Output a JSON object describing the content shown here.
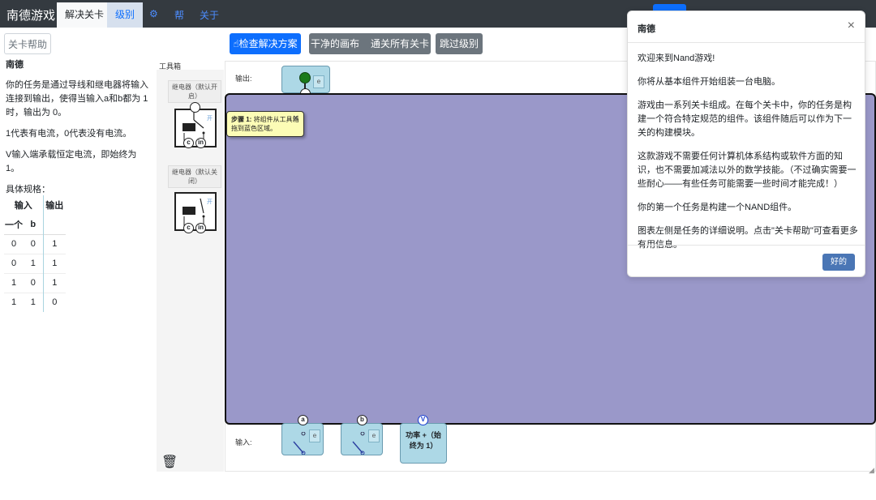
{
  "navbar": {
    "brand": "南德游戏",
    "tabs": [
      {
        "label": "解决关卡"
      },
      {
        "label": "级别"
      }
    ],
    "links": [
      {
        "label": "⚙"
      },
      {
        "label": "帮"
      },
      {
        "label": "关于"
      }
    ]
  },
  "toolbar": {
    "help_label": "关卡帮助",
    "check_label": "检查解决方案",
    "clear_label": "干净的画布",
    "pass_all_label": "通关所有关卡",
    "skip_label": "跳过级别"
  },
  "spec": {
    "title": "南德",
    "p1": "你的任务是通过导线和继电器将输入连接到输出，使得当输入a和b都为 1 时，输出为 0。",
    "p2": "1代表有电流，0代表没有电流。",
    "p3": "V输入端承载恒定电流，即始终为 1。",
    "p4": "具体规格：",
    "table": {
      "header_in": "输入",
      "header_out": "输出",
      "sub_a": "一个",
      "sub_b": "b",
      "rows": [
        [
          "0",
          "0",
          "1"
        ],
        [
          "0",
          "1",
          "1"
        ],
        [
          "1",
          "0",
          "1"
        ],
        [
          "1",
          "1",
          "0"
        ]
      ]
    }
  },
  "toolbox": {
    "label": "工具箱",
    "relay_on": "继电器（默认开启）",
    "relay_off": "继电器（默认关闭）",
    "port_c": "c",
    "port_in": "in"
  },
  "canvas": {
    "output_label": "输出:",
    "input_label": "输入:",
    "input_a": "a",
    "input_b": "b",
    "input_v": "V",
    "power_label": "功率 +（始终为 1）",
    "mini_e": "e"
  },
  "tooltip": {
    "step": "步骤 1:",
    "text": "将组件从工具箱拖到蓝色区域。",
    "close": "✕"
  },
  "modal": {
    "title": "南德",
    "close": "×",
    "p1": "欢迎来到Nand游戏!",
    "p2": "你将从基本组件开始组装一台电脑。",
    "p3": "游戏由一系列关卡组成。在每个关卡中，你的任务是构建一个符合特定规范的组件。该组件随后可以作为下一关的构建模块。",
    "p4": "这款游戏不需要任何计算机体系结构或软件方面的知识，也不需要加减法以外的数学技能。（不过确实需要一些耐心——有些任务可能需要一些时间才能完成！）",
    "p5": "你的第一个任务是构建一个NAND组件。",
    "p6": "图表左侧是任务的详细说明。点击\"关卡帮助\"可查看更多有用信息。",
    "ok_label": "好的"
  },
  "colors": {
    "canvas": "#9a98c9",
    "component": "#add8e6",
    "primary": "#0d6efd",
    "navbar": "#343a40",
    "tooltip": "#fcfcb6"
  }
}
